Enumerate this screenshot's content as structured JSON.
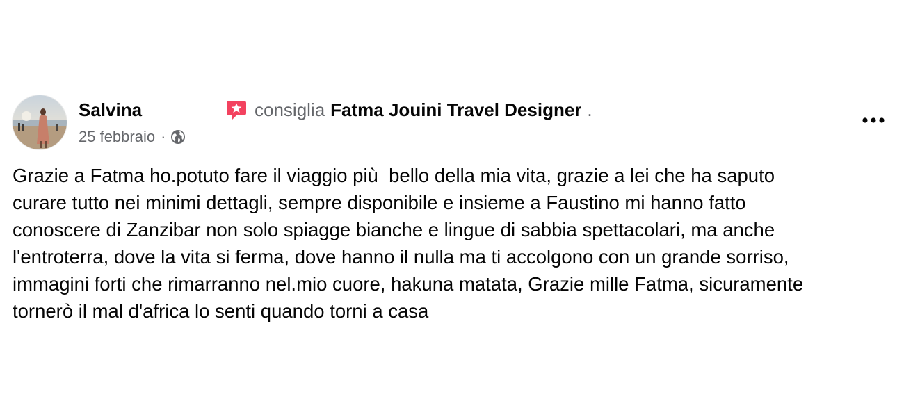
{
  "post": {
    "author": "Salvina",
    "verb": "consiglia",
    "page_name": "Fatma Jouini Travel Designer",
    "trailing": ".",
    "date": "25 febbraio",
    "separator": "·",
    "audience_icon": "globe-icon",
    "recommend_icon": "recommend-star-icon",
    "more_icon": "more-options-icon",
    "body": "Grazie a Fatma ho.potuto fare il viaggio più  bello della mia vita, grazie a lei che ha saputo\ncurare tutto nei minimi dettagli, sempre disponibile e insieme a Faustino mi hanno fatto\nconoscere di Zanzibar non solo spiagge bianche e lingue di sabbia spettacolari, ma anche\nl'entroterra, dove la vita si ferma, dove hanno il nulla ma ti accolgono con un grande sorriso,\nimmagini forti che rimarranno nel.mio cuore, hakuna matata, Grazie mille Fatma, sicuramente\ntornerò il mal d'africa lo senti quando torni a casa"
  },
  "colors": {
    "text_primary": "#050505",
    "text_secondary": "#65676b",
    "recommend_red": "#f3425f",
    "background": "#ffffff"
  }
}
